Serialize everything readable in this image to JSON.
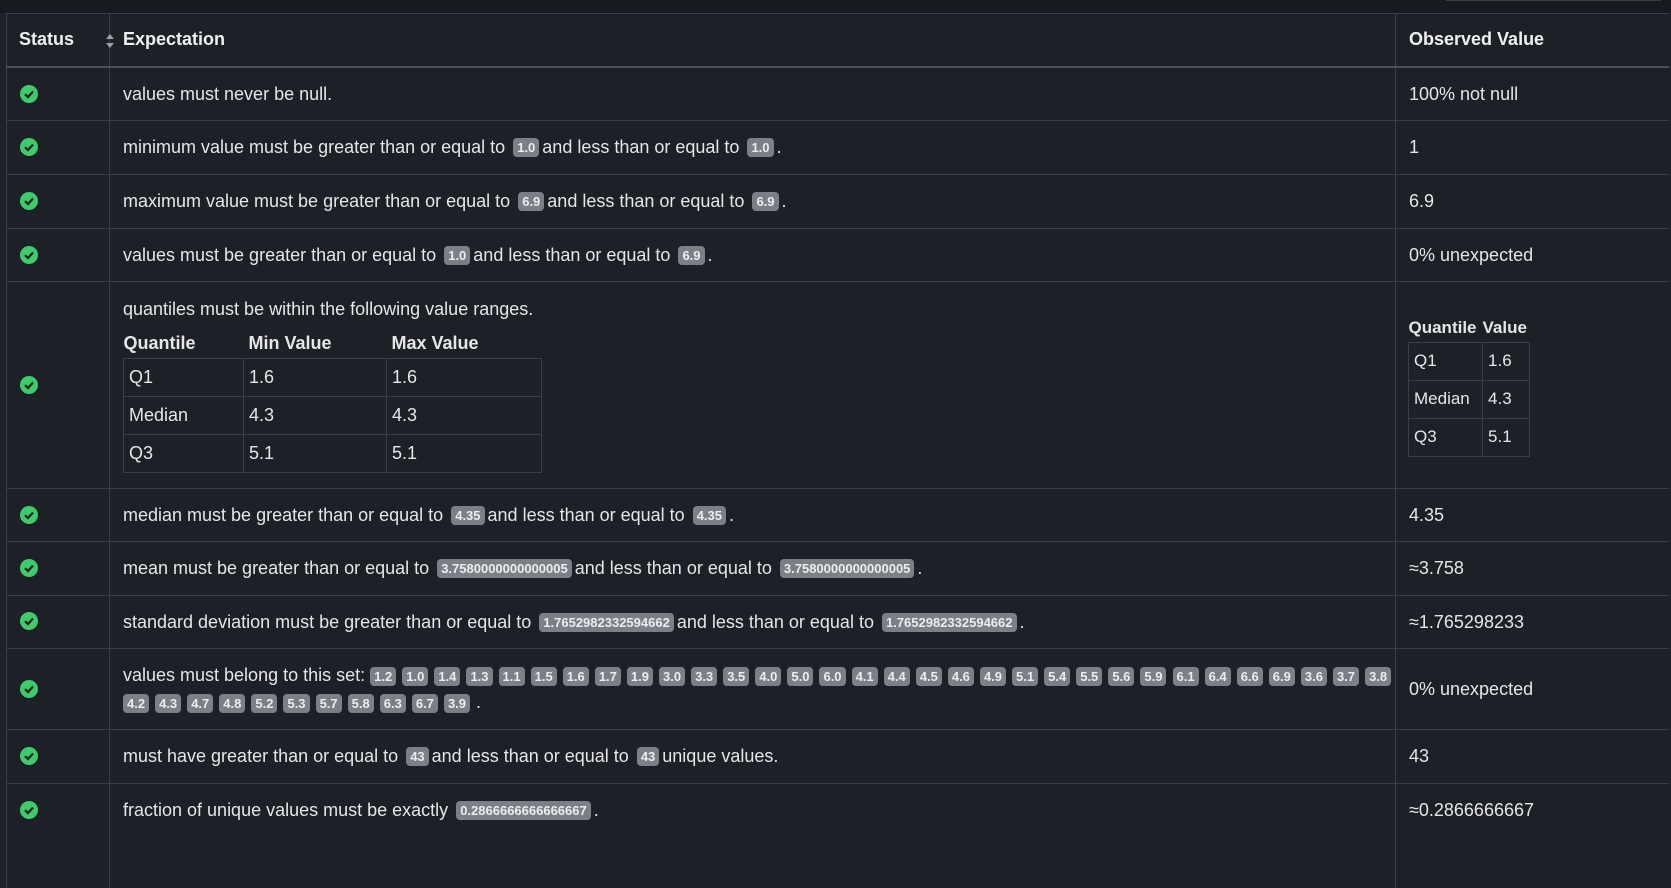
{
  "headers": {
    "status": "Status",
    "expectation": "Expectation",
    "observed": "Observed Value"
  },
  "rows": [
    {
      "status": "success",
      "text": "values must never be null.",
      "observed": "100% not null"
    },
    {
      "status": "success",
      "pre": "minimum value must be greater than or equal to",
      "a": "1.0",
      "mid": "and less than or equal to",
      "b": "1.0",
      "post": ".",
      "observed": "1"
    },
    {
      "status": "success",
      "pre": "maximum value must be greater than or equal to",
      "a": "6.9",
      "mid": "and less than or equal to",
      "b": "6.9",
      "post": ".",
      "observed": "6.9"
    },
    {
      "status": "success",
      "pre": "values must be greater than or equal to",
      "a": "1.0",
      "mid": "and less than or equal to",
      "b": "6.9",
      "post": ".",
      "observed": "0% unexpected"
    },
    {
      "status": "success",
      "text": "quantiles must be within the following value ranges.",
      "quantile_table": {
        "headers": [
          "Quantile",
          "Min Value",
          "Max Value"
        ],
        "rows": [
          [
            "Q1",
            "1.6",
            "1.6"
          ],
          [
            "Median",
            "4.3",
            "4.3"
          ],
          [
            "Q3",
            "5.1",
            "5.1"
          ]
        ]
      },
      "observed_table": {
        "headers": [
          "Quantile",
          "Value"
        ],
        "rows": [
          [
            "Q1",
            "1.6"
          ],
          [
            "Median",
            "4.3"
          ],
          [
            "Q3",
            "5.1"
          ]
        ]
      }
    },
    {
      "status": "success",
      "pre": "median must be greater than or equal to",
      "a": "4.35",
      "mid": "and less than or equal to",
      "b": "4.35",
      "post": ".",
      "observed": "4.35"
    },
    {
      "status": "success",
      "pre": "mean must be greater than or equal to",
      "a": "3.7580000000000005",
      "mid": "and less than or equal to",
      "b": "3.7580000000000005",
      "post": ".",
      "observed": "≈3.758"
    },
    {
      "status": "success",
      "pre": "standard deviation must be greater than or equal to",
      "a": "1.7652982332594662",
      "mid": "and less than or equal to",
      "b": "1.7652982332594662",
      "post": ".",
      "observed": "≈1.765298233"
    },
    {
      "status": "success",
      "pre": "values must belong to this set:",
      "set": [
        "1.2",
        "1.0",
        "1.4",
        "1.3",
        "1.1",
        "1.5",
        "1.6",
        "1.7",
        "1.9",
        "3.0",
        "3.3",
        "3.5",
        "4.0",
        "5.0",
        "6.0",
        "4.1",
        "4.4",
        "4.5",
        "4.6",
        "4.9",
        "5.1",
        "5.4",
        "5.5",
        "5.6",
        "5.9",
        "6.1",
        "6.4",
        "6.6",
        "6.9",
        "3.6",
        "3.7",
        "3.8",
        "4.2",
        "4.3",
        "4.7",
        "4.8",
        "5.2",
        "5.3",
        "5.7",
        "5.8",
        "6.3",
        "6.7",
        "3.9"
      ],
      "post": ".",
      "observed": "0% unexpected"
    },
    {
      "status": "success",
      "pre": "must have greater than or equal to",
      "a": "43",
      "mid": "and less than or equal to",
      "b": "43",
      "post": "unique values.",
      "observed": "43"
    },
    {
      "status": "success",
      "pre": "fraction of unique values must be exactly",
      "a": "0.2866666666666667",
      "post": ".",
      "observed": "≈0.2866666667"
    }
  ],
  "colors": {
    "background": "#1d2026",
    "border": "#3a3f47",
    "success": "#3ecb69",
    "chip": "#7c7f85"
  },
  "icons": {
    "status_ok": "check-circle-icon",
    "sort": "sort-icon"
  }
}
